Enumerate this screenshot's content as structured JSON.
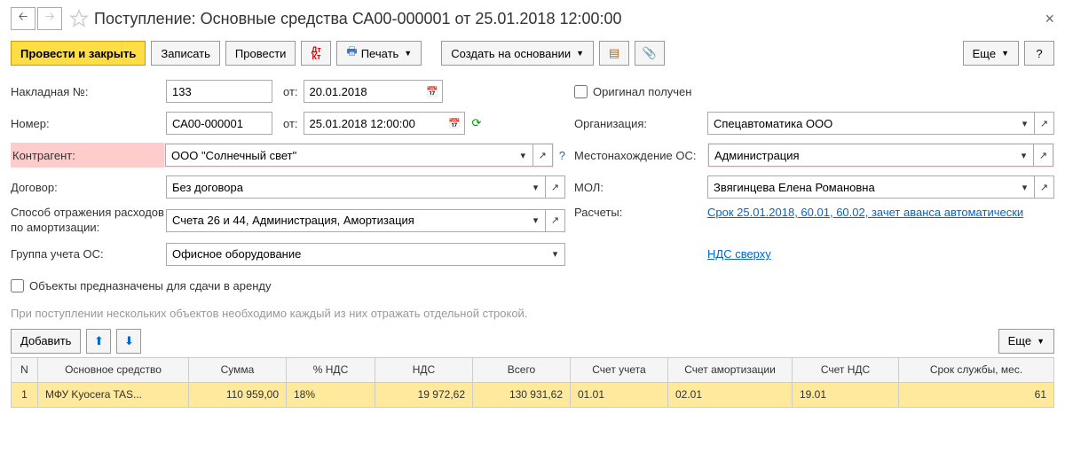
{
  "title": "Поступление: Основные средства СА00-000001 от 25.01.2018 12:00:00",
  "toolbar": {
    "post_close": "Провести и закрыть",
    "save": "Записать",
    "post": "Провести",
    "print": "Печать",
    "create_based": "Создать на основании",
    "more": "Еще"
  },
  "labels": {
    "invoice_no": "Накладная №:",
    "from": "от:",
    "number": "Номер:",
    "contractor": "Контрагент:",
    "contract": "Договор:",
    "depr_method": "Способ отражения расходов по амортизации:",
    "os_group": "Группа учета ОС:",
    "original": "Оригинал получен",
    "organization": "Организация:",
    "os_location": "Местонахождение ОС:",
    "mol": "МОЛ:",
    "calc": "Расчеты:",
    "rent": "Объекты предназначены для сдачи в аренду",
    "add": "Добавить"
  },
  "values": {
    "invoice_no": "133",
    "invoice_date": "20.01.2018",
    "number": "СА00-000001",
    "number_date": "25.01.2018 12:00:00",
    "contractor": "ООО \"Солнечный свет\"",
    "contract": "Без договора",
    "depr_method": "Счета 26 и 44, Администрация, Амортизация",
    "os_group": "Офисное оборудование",
    "organization": "Спецавтоматика ООО",
    "os_location": "Администрация",
    "mol": "Звягинцева Елена Романовна",
    "calc_link": "Срок 25.01.2018, 60.01, 60.02, зачет аванса автоматически",
    "vat_link": "НДС сверху"
  },
  "hint": "При поступлении нескольких объектов необходимо каждый из них отражать отдельной строкой.",
  "table": {
    "headers": {
      "n": "N",
      "asset": "Основное средство",
      "sum": "Сумма",
      "vat_pct": "% НДС",
      "vat": "НДС",
      "total": "Всего",
      "acc": "Счет учета",
      "acc_depr": "Счет амортизации",
      "acc_vat": "Счет НДС",
      "life": "Срок службы, мес."
    },
    "row": {
      "n": "1",
      "asset": "МФУ Kyocera TAS...",
      "sum": "110 959,00",
      "vat_pct": "18%",
      "vat": "19 972,62",
      "total": "130 931,62",
      "acc": "01.01",
      "acc_depr": "02.01",
      "acc_vat": "19.01",
      "life": "61"
    }
  }
}
